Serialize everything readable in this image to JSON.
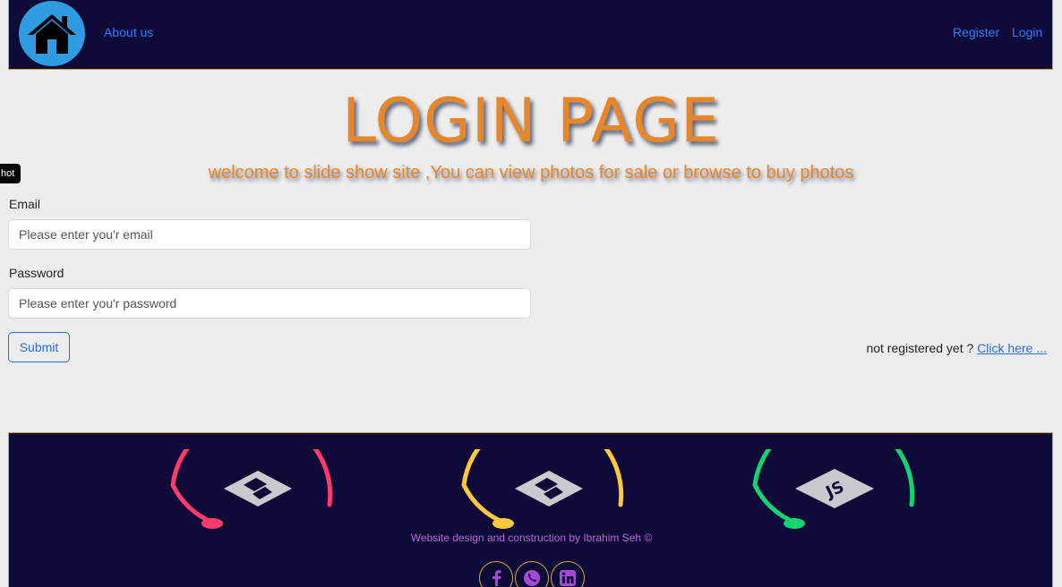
{
  "navbar": {
    "home_icon": "home-icon",
    "about_label": "About us",
    "register_label": "Register",
    "login_label": "Login"
  },
  "hero": {
    "title": "LOGIN PAGE",
    "subtitle": "welcome to slide show site ,You can view photos for sale or browse to buy photos"
  },
  "hot_tag": "hot",
  "form": {
    "email_label": "Email",
    "email_placeholder": "Please enter you'r email",
    "password_label": "Password",
    "password_placeholder": "Please enter you'r password",
    "submit_label": "Submit",
    "register_prompt": "not registered yet ? ",
    "register_link": "Click here ..."
  },
  "footer": {
    "badges": [
      {
        "icon": "html5-icon",
        "color": "#ff3b6b"
      },
      {
        "icon": "css3-icon",
        "color": "#ffc93c"
      },
      {
        "icon": "js-icon",
        "color": "#14d373"
      }
    ],
    "credit": "Website design and construction by Ibrahim Seh ©",
    "social": [
      "facebook-icon",
      "whatsapp-icon",
      "linkedin-icon"
    ]
  },
  "colors": {
    "nav_bg": "#0f0b38",
    "accent_orange": "#e8862a",
    "link_blue": "#2f7dff",
    "border_gold": "#c9a640"
  }
}
